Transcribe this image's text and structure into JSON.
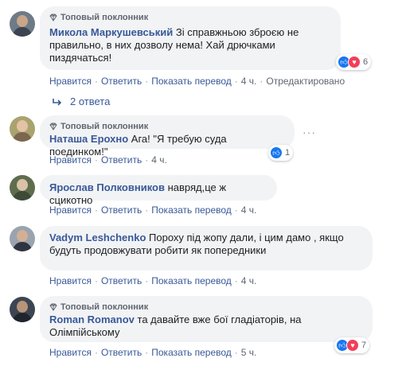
{
  "badge_text": "Топовый поклонник",
  "actions": {
    "like": "Нравится",
    "reply": "Ответить",
    "translate": "Показать перевод",
    "separator": "·"
  },
  "comments": [
    {
      "author": "Микола Маркушевський",
      "lines": [
        "Зі справжньою зброєю не",
        "правильно, в них дозволу нема! Хай дрючками",
        "пиздячаться!"
      ],
      "time": "4 ч.",
      "edited": "Отредактировано",
      "reactions": "6",
      "replies": "2 ответа"
    },
    {
      "author": "Наташа Ерохно",
      "text": "Ага! \"Я требую суда поединком!\"",
      "time": "4 ч.",
      "reactions": "1"
    },
    {
      "author": "Ярослав Полковников",
      "text": "навряд,це ж сцикотно",
      "time": "4 ч."
    },
    {
      "author": "Vadym Leshchenko",
      "lines": [
        "Пороху під жопу дали, і цим дамо , якщо",
        "будуть продовжувати робити як попередники"
      ],
      "time": "4 ч."
    },
    {
      "author": "Roman Romanov",
      "lines": [
        "та давайте вже бої гладіаторів, на",
        "Олімпійському"
      ],
      "time": "5 ч.",
      "reactions": "7"
    }
  ],
  "colors": {
    "link": "#385898",
    "bubble": "#f2f3f5",
    "meta": "#606770",
    "like": "#1877f2",
    "love": "#f33e58"
  }
}
